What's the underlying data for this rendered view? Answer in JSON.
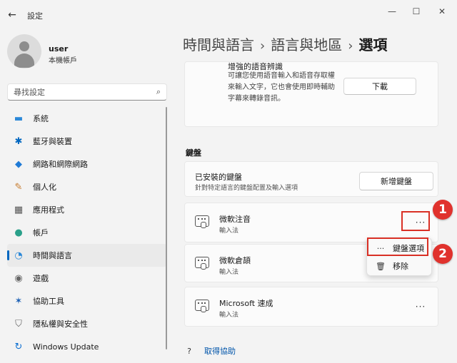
{
  "window": {
    "app_title": "設定",
    "back_icon": "←",
    "minimize_icon": "—",
    "maximize_icon": "☐",
    "close_icon": "✕"
  },
  "profile": {
    "name": "user",
    "subtitle": "本機帳戶"
  },
  "search": {
    "placeholder": "尋找設定",
    "icon": "⌕"
  },
  "sidebar": {
    "items": [
      {
        "label": "系統",
        "icon": "▬",
        "color": "#2b88d8"
      },
      {
        "label": "藍牙與裝置",
        "icon": "✱",
        "color": "#0067c0"
      },
      {
        "label": "網路和網際網路",
        "icon": "◆",
        "color": "#1f7ad6"
      },
      {
        "label": "個人化",
        "icon": "✎",
        "color": "#c67a2b"
      },
      {
        "label": "應用程式",
        "icon": "▦",
        "color": "#555555"
      },
      {
        "label": "帳戶",
        "icon": "●",
        "color": "#2aa08a"
      },
      {
        "label": "時間與語言",
        "icon": "◔",
        "color": "#2b88d8",
        "active": true
      },
      {
        "label": "遊戲",
        "icon": "◉",
        "color": "#666666"
      },
      {
        "label": "協助工具",
        "icon": "✶",
        "color": "#1a5fb4"
      },
      {
        "label": "隱私權與安全性",
        "icon": "⛉",
        "color": "#666666"
      },
      {
        "label": "Windows Update",
        "icon": "↻",
        "color": "#0a6ed1"
      }
    ]
  },
  "breadcrumb": {
    "crumb1": "時間與語言",
    "sep": "›",
    "crumb2": "語言與地區",
    "crumb3": "選項"
  },
  "speech": {
    "title": "增強的語音辨識",
    "description": "可讓您使用語音輸入和語音存取權來輸入文字，它也會使用即時輔助字幕來轉錄音訊。",
    "download_label": "下載"
  },
  "keyboard": {
    "section_title": "鍵盤",
    "installed_title": "已安裝的鍵盤",
    "installed_sub": "針對特定語言的鍵盤配置及輸入選項",
    "add_label": "新增鍵盤",
    "ime": [
      {
        "name": "微軟注音",
        "type": "輸入法",
        "more": "···"
      },
      {
        "name": "微軟倉頡",
        "type": "輸入法",
        "more": "···"
      },
      {
        "name": "Microsoft 速成",
        "type": "輸入法",
        "more": "···"
      }
    ]
  },
  "context_menu": {
    "options_icon": "···",
    "options_label": "鍵盤選項",
    "remove_icon": "🗑",
    "remove_label": "移除"
  },
  "annotations": {
    "badge1": "1",
    "badge2": "2",
    "color": "#e0322d"
  },
  "help": {
    "label": "取得協助",
    "icon": "?"
  }
}
